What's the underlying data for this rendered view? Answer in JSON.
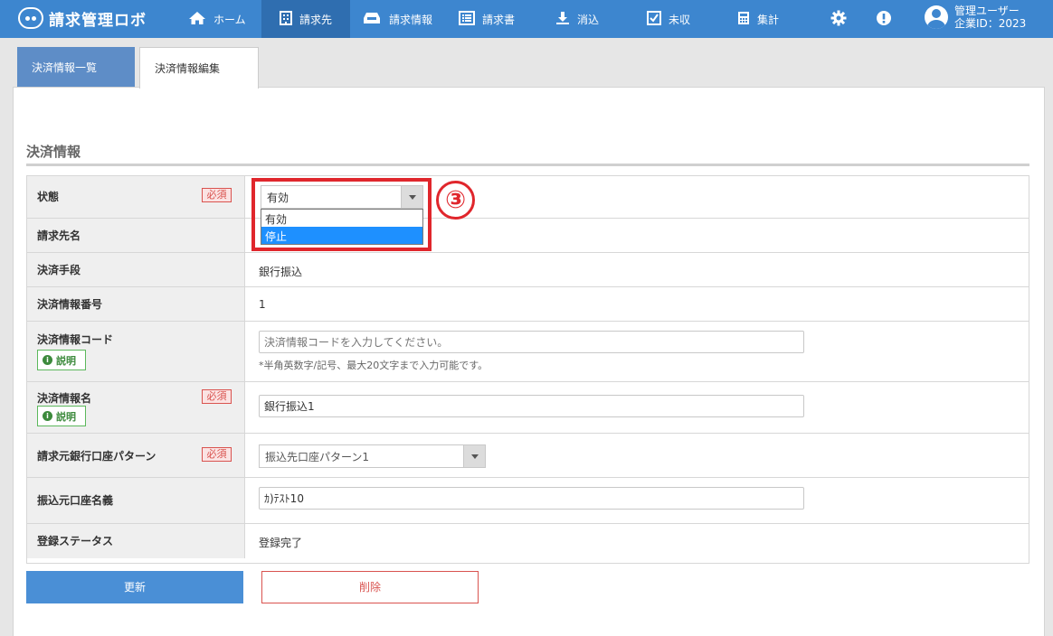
{
  "app": {
    "title": "請求管理ロボ"
  },
  "nav": {
    "home": "ホーム",
    "billing_dest": "請求先",
    "billing_info": "請求情報",
    "invoice": "請求書",
    "reconcile": "消込",
    "uncollected": "未収",
    "aggregate": "集計"
  },
  "user": {
    "name": "管理ユーザー",
    "company_id": "企業ID：2023"
  },
  "tabs": {
    "list": "決済情報一覧",
    "edit": "決済情報編集"
  },
  "section": {
    "title": "決済情報"
  },
  "badges": {
    "required": "必須",
    "explain": "説明"
  },
  "form": {
    "status": {
      "label": "状態",
      "selected": "有効",
      "options": [
        "有効",
        "停止"
      ],
      "highlighted_option": "停止"
    },
    "billing_name": {
      "label": "請求先名"
    },
    "payment_method": {
      "label": "決済手段",
      "value": "銀行振込"
    },
    "payment_number": {
      "label": "決済情報番号",
      "value": "1"
    },
    "payment_code": {
      "label": "決済情報コード",
      "placeholder": "決済情報コードを入力してください。",
      "hint": "*半角英数字/記号、最大20文字まで入力可能です。"
    },
    "payment_name": {
      "label": "決済情報名",
      "value": "銀行振込1"
    },
    "bank_pattern": {
      "label": "請求元銀行口座パターン",
      "selected": "振込先口座パターン1"
    },
    "transfer_name": {
      "label": "振込元口座名義",
      "value": "ｶ)ﾃｽﾄ10"
    },
    "reg_status": {
      "label": "登録ステータス",
      "value": "登録完了"
    }
  },
  "annotation": {
    "marker": "③"
  },
  "buttons": {
    "update": "更新",
    "delete": "削除"
  },
  "colors": {
    "header": "#3d86cf",
    "accent_red": "#e0262c",
    "required": "#d9534f",
    "explain": "#5cb85c"
  }
}
